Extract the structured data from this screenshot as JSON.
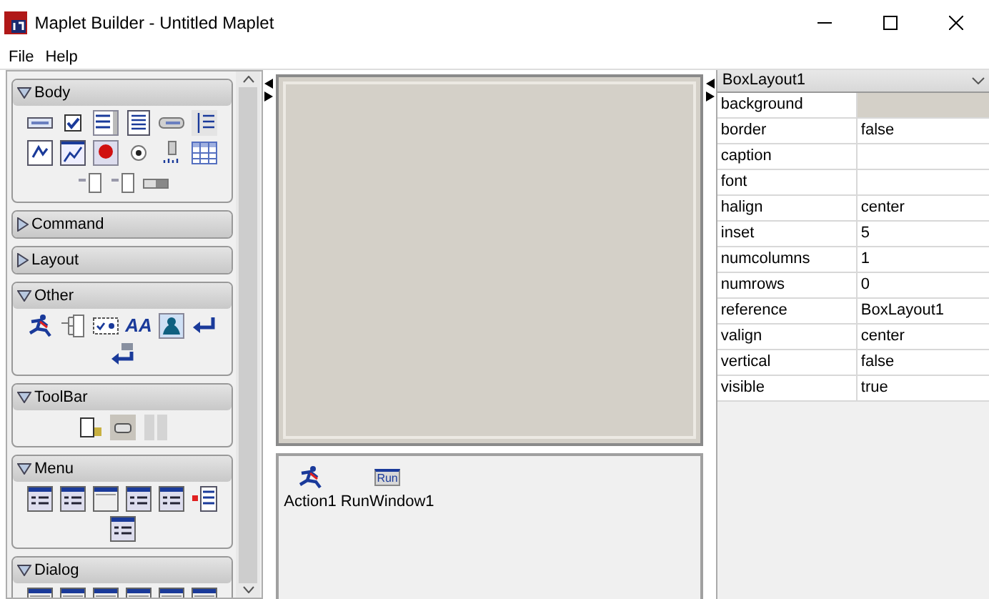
{
  "window": {
    "title": "Maplet Builder - Untitled Maplet"
  },
  "menu": [
    "File",
    "Help"
  ],
  "palette": [
    {
      "label": "Body",
      "expanded": true,
      "items": [
        {
          "kind": "text-field"
        },
        {
          "kind": "check-box"
        },
        {
          "kind": "text-box"
        },
        {
          "kind": "list-box"
        },
        {
          "kind": "button"
        },
        {
          "kind": "tree-list"
        },
        {
          "kind": "math-field"
        },
        {
          "kind": "plotter"
        },
        {
          "kind": "red-ball"
        },
        {
          "kind": "radio"
        },
        {
          "kind": "slider"
        },
        {
          "kind": "table"
        },
        {
          "kind": "spinner"
        },
        {
          "kind": "spinner"
        },
        {
          "kind": "toggle"
        }
      ]
    },
    {
      "label": "Command",
      "expanded": false
    },
    {
      "label": "Layout",
      "expanded": false
    },
    {
      "label": "Other",
      "expanded": true,
      "items": [
        {
          "kind": "runner"
        },
        {
          "kind": "tree-node"
        },
        {
          "kind": "check-group"
        },
        {
          "kind": "font",
          "label": "AA"
        },
        {
          "kind": "image"
        },
        {
          "kind": "return-arrow"
        },
        {
          "kind": "return-arrow-grid"
        }
      ]
    },
    {
      "label": "ToolBar",
      "expanded": true,
      "items": [
        {
          "kind": "doc"
        },
        {
          "kind": "button-frame"
        },
        {
          "kind": "separator"
        }
      ]
    },
    {
      "label": "Menu",
      "expanded": true,
      "items": [
        {
          "kind": "menu"
        },
        {
          "kind": "menu"
        },
        {
          "kind": "menu-plain"
        },
        {
          "kind": "menu"
        },
        {
          "kind": "menu"
        },
        {
          "kind": "menu-popup"
        },
        {
          "kind": "menu"
        }
      ]
    },
    {
      "label": "Dialog",
      "expanded": true,
      "items": [
        {
          "kind": "menu-plain"
        },
        {
          "kind": "menu-plain"
        },
        {
          "kind": "menu-plain"
        },
        {
          "kind": "menu-plain"
        },
        {
          "kind": "menu-plain"
        },
        {
          "kind": "menu-plain"
        }
      ]
    }
  ],
  "components": [
    {
      "kind": "runner",
      "label": "Action1"
    },
    {
      "kind": "run",
      "label": "RunWindow1",
      "icon_label": "Run"
    }
  ],
  "properties": {
    "selector": "BoxLayout1",
    "rows": [
      {
        "name": "background",
        "color": "#d4d0c8"
      },
      {
        "name": "border",
        "value": "false"
      },
      {
        "name": "caption"
      },
      {
        "name": "font"
      },
      {
        "name": "halign",
        "value": "center"
      },
      {
        "name": "inset",
        "value": "5"
      },
      {
        "name": "numcolumns",
        "value": "1"
      },
      {
        "name": "numrows",
        "value": "0"
      },
      {
        "name": "reference",
        "value": "BoxLayout1"
      },
      {
        "name": "valign",
        "value": "center"
      },
      {
        "name": "vertical",
        "value": "false"
      },
      {
        "name": "visible",
        "value": "true"
      }
    ]
  }
}
